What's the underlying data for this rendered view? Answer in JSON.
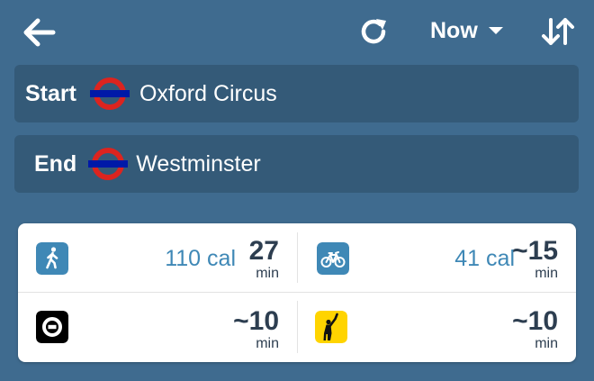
{
  "header": {
    "back_icon": "arrow-left-icon",
    "refresh_icon": "refresh-icon",
    "time_selector": "Now",
    "swap_icon": "swap-vertical-icon"
  },
  "route": {
    "start": {
      "label": "Start",
      "name": "Oxford Circus",
      "icon": "tube-roundel-icon"
    },
    "end": {
      "label": "End",
      "name": "Westminster",
      "icon": "tube-roundel-icon"
    }
  },
  "options": [
    {
      "mode": "walk",
      "icon": "walking-person-icon",
      "calories": "110 cal",
      "duration": "27",
      "unit": "min"
    },
    {
      "mode": "bike",
      "icon": "bicycle-icon",
      "calories": "41 cal",
      "duration": "~15",
      "unit": "min"
    },
    {
      "mode": "uber",
      "icon": "uber-icon",
      "calories": "",
      "duration": "~10",
      "unit": "min"
    },
    {
      "mode": "taxi",
      "icon": "taxi-hail-icon",
      "calories": "",
      "duration": "~10",
      "unit": "min"
    }
  ],
  "colors": {
    "background": "#3f6b8f",
    "field": "#345a78",
    "accent": "#3f88b6",
    "roundel_red": "#dc241f",
    "roundel_blue": "#0019a8",
    "taxi_yellow": "#ffd400"
  }
}
